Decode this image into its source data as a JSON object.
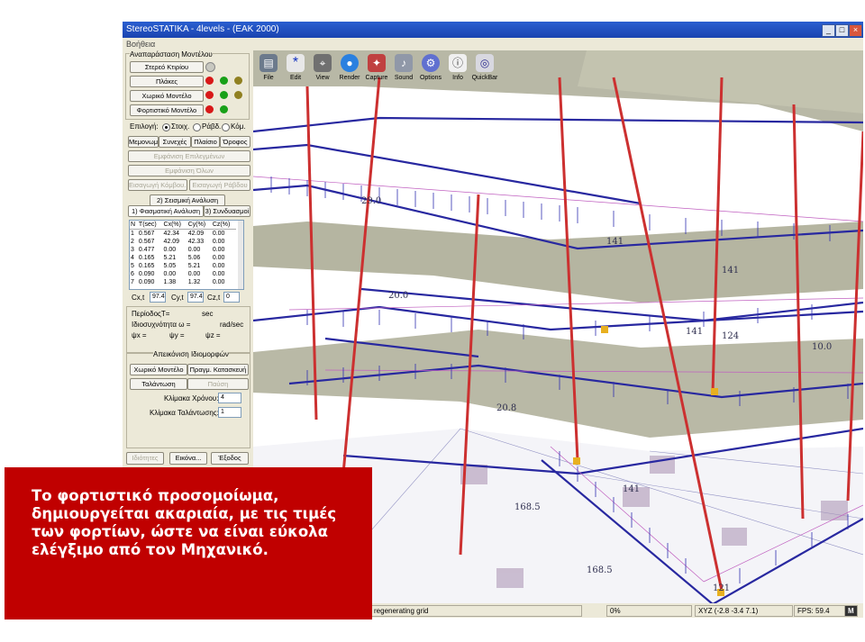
{
  "window": {
    "title": "StereoSTATIKA - 4levels - (EAK 2000)",
    "minimize": "_",
    "maximize": "□",
    "close": "×"
  },
  "menu": {
    "help": "Βοήθεια"
  },
  "panel": {
    "display_group": "Αναπαράσταση Μοντέλου",
    "model_buttons": [
      "Στερεό Κτιρίου",
      "Πλάκες",
      "Χωρικό Μοντέλο",
      "Φορτιστικό Μοντέλο"
    ],
    "select_label": "Επιλογή:",
    "radio_options": [
      "Στοιχ.",
      "Ράβδ.",
      "Κόμ."
    ],
    "view_buttons": [
      "Μεμονωμ.",
      "Συνεχές",
      "Πλαίσιο",
      "Όροφος"
    ],
    "show_selected": "Εμφάνιση Επιλεγμένων",
    "show_all": "Εμφάνιση Όλων",
    "insert_node": "Εισαγωγή Κόμβου...",
    "insert_bar": "Εισαγωγή Ράβδου",
    "tab_seismic": "2) Σεισμική Ανάλυση",
    "tab_spectral": "1) Φασματική Ανάλυση",
    "tab_combos": "3) Συνδυασμοί",
    "table_headers": [
      "N",
      "T(sec)",
      "Cx(%)",
      "Cy(%)",
      "Cz(%)"
    ],
    "table_rows": [
      [
        "1",
        "0.567",
        "42.34",
        "42.09",
        "0.00"
      ],
      [
        "2",
        "0.567",
        "42.09",
        "42.33",
        "0.00"
      ],
      [
        "3",
        "0.477",
        "0.00",
        "0.00",
        "0.00"
      ],
      [
        "4",
        "0.165",
        "5.21",
        "5.06",
        "0.00"
      ],
      [
        "5",
        "0.165",
        "5.05",
        "5.21",
        "0.00"
      ],
      [
        "6",
        "0.090",
        "0.00",
        "0.00",
        "0.00"
      ],
      [
        "7",
        "0.090",
        "1.38",
        "1.32",
        "0.00"
      ]
    ],
    "cxt_label": "Cx,t",
    "cxt_value": "97.4",
    "cyt_label": "Cy,t",
    "cyt_value": "97.4",
    "czt_label": "Cz,t",
    "czt_value": "0",
    "period_label": "ΠερίοδοςT=",
    "period_unit": "sec",
    "freq_label": "Ιδιοσυχνότητα ω =",
    "freq_unit": "rad/sec",
    "psi_x": "ψx =",
    "psi_y": "ψy =",
    "psi_z": "ψz =",
    "modes_group": "Απεικόνιση Ιδιομορφών",
    "spatial_model": "Χωρικό Μοντέλο",
    "real_structure": "Πραγμ. Κατασκευή",
    "oscillation": "Ταλάντωση",
    "pause": "Παύση",
    "time_scale_label": "Κλίμακα Χρόνου:",
    "time_scale_value": "4",
    "osc_scale_label": "Κλίμακα Ταλάντωσης:",
    "osc_scale_value": "1",
    "properties": "Ιδιότητες",
    "image": "Εικόνα...",
    "exit": "Έξοδος"
  },
  "toolbar": {
    "items": [
      "File",
      "Edit",
      "View",
      "Render",
      "Capture",
      "Sound",
      "Options",
      "Info",
      "QuickBar"
    ],
    "icons": [
      "file-icon",
      "edit-icon",
      "view-icon",
      "render-icon",
      "capture-icon",
      "sound-icon",
      "options-icon",
      "info-icon",
      "quickbar-icon"
    ]
  },
  "viewport_labels": [
    "29.0",
    "141",
    "20.0",
    "141",
    "20.8",
    "141",
    "124",
    "10.0",
    "141",
    "121",
    "168.5",
    "168.5"
  ],
  "statusbar": {
    "message": "regenerating grid",
    "progress": "0%",
    "coords": "XYZ (-2.8 -3.4 7.1)",
    "fps": "FPS: 59.4",
    "m_badge": "M"
  },
  "caption": "Το φορτιστικό προσομοίωμα, δημιουργείται ακαριαία, με τις τιμές των φορτίων, ώστε να είναι εύκολα ελέγξιμο από τον Μηχανικό.",
  "colors": {
    "title_bar": "#1a43b0",
    "caption_bg": "#c00000",
    "beams": "#3030a0",
    "columns": "#c83232",
    "load_arrows": "#c060c0",
    "slab": "#a8a890"
  }
}
